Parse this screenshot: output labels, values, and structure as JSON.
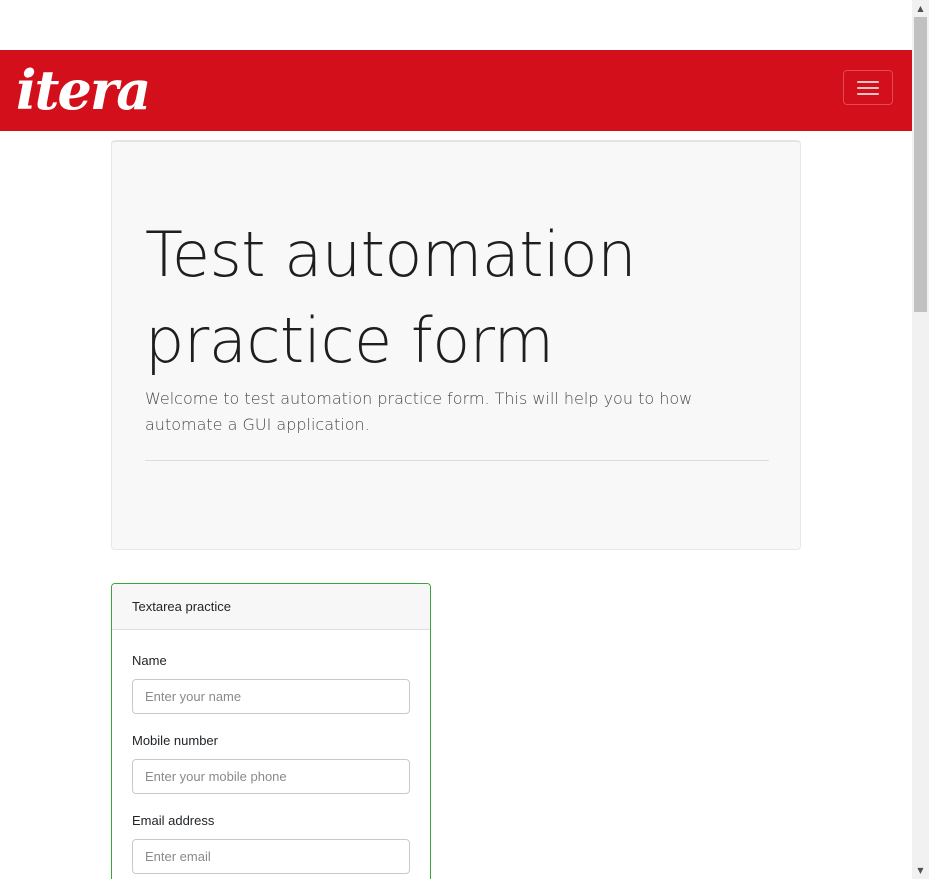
{
  "navbar": {
    "brand_text": "itera",
    "brand_color": "#d30f1b",
    "toggle_icon": "hamburger-menu-icon"
  },
  "hero": {
    "title": "Test automation practice form",
    "lead": "Welcome to test automation practice form. This will help you to how automate a GUI application."
  },
  "textarea_card": {
    "header": "Textarea practice",
    "accent_color": "#3aa53a",
    "fields": [
      {
        "label": "Name",
        "placeholder": "Enter your name"
      },
      {
        "label": "Mobile number",
        "placeholder": "Enter your mobile phone"
      },
      {
        "label": "Email address",
        "placeholder": "Enter email"
      }
    ]
  },
  "scrollbar": {
    "up_icon": "arrow-up-icon",
    "down_icon": "arrow-down-icon"
  }
}
